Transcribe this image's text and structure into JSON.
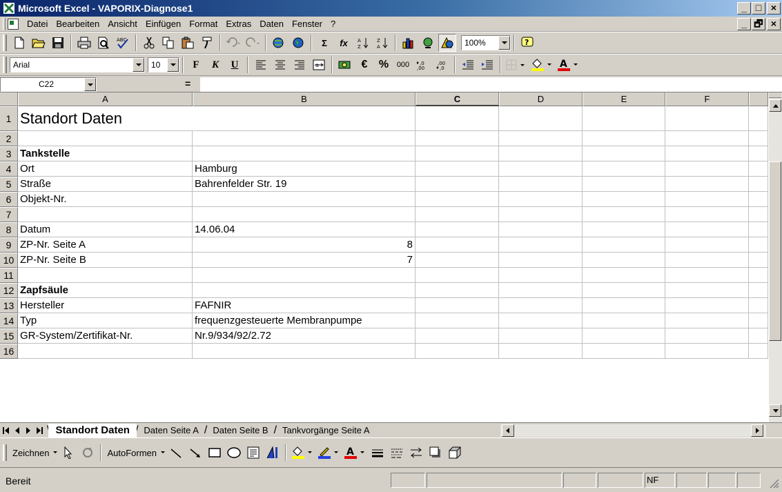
{
  "window": {
    "title": "Microsoft Excel - VAPORIX-Diagnose1",
    "min_glyph": "_",
    "max_glyph": "□",
    "close_glyph": "×",
    "restore_glyph": "🗗"
  },
  "menu": {
    "items": [
      "Datei",
      "Bearbeiten",
      "Ansicht",
      "Einfügen",
      "Format",
      "Extras",
      "Daten",
      "Fenster",
      "?"
    ]
  },
  "format_toolbar": {
    "font": "Arial",
    "size": "10",
    "bold": "F",
    "italic": "K",
    "underline": "U",
    "currency": "€",
    "percent": "%",
    "thousands": "000"
  },
  "standard_toolbar": {
    "sum": "Σ",
    "function": "fx",
    "zoom": "100%"
  },
  "formula_bar": {
    "name_box": "C22",
    "equals": "=",
    "content": ""
  },
  "columns": [
    "A",
    "B",
    "C",
    "D",
    "E",
    "F"
  ],
  "selected_column": "C",
  "rows": [
    {
      "num": "1",
      "a": "Standort Daten",
      "b": ""
    },
    {
      "num": "2",
      "a": "",
      "b": ""
    },
    {
      "num": "3",
      "a": "Tankstelle",
      "b": ""
    },
    {
      "num": "4",
      "a": "Ort",
      "b": "Hamburg"
    },
    {
      "num": "5",
      "a": "Straße",
      "b": "Bahrenfelder Str. 19"
    },
    {
      "num": "6",
      "a": "Objekt-Nr.",
      "b": ""
    },
    {
      "num": "7",
      "a": "",
      "b": ""
    },
    {
      "num": "8",
      "a": "Datum",
      "b": "14.06.04"
    },
    {
      "num": "9",
      "a": "ZP-Nr. Seite A",
      "b": "8"
    },
    {
      "num": "10",
      "a": "ZP-Nr. Seite B",
      "b": "7"
    },
    {
      "num": "11",
      "a": "",
      "b": ""
    },
    {
      "num": "12",
      "a": "Zapfsäule",
      "b": ""
    },
    {
      "num": "13",
      "a": "Hersteller",
      "b": "FAFNIR"
    },
    {
      "num": "14",
      "a": "Typ",
      "b": "frequenzgesteuerte Membranpumpe"
    },
    {
      "num": "15",
      "a": "GR-System/Zertifikat-Nr.",
      "b": "Nr.9/934/92/2.72"
    },
    {
      "num": "16",
      "a": "",
      "b": ""
    }
  ],
  "sheet_tabs": [
    "Standort Daten",
    "Daten Seite A",
    "Daten Seite B",
    "Tankvorgänge Seite A"
  ],
  "active_sheet": "Standort Daten",
  "drawing_toolbar": {
    "draw": "Zeichnen",
    "autoshapes": "AutoFormen"
  },
  "status": {
    "text": "Bereit",
    "nf": "NF"
  },
  "colors": {
    "title_start": "#0a246a",
    "title_end": "#a6caf0",
    "face": "#d4d0c8",
    "font_color_red": "#e00000",
    "fill_color_yellow": "#ffff00"
  }
}
